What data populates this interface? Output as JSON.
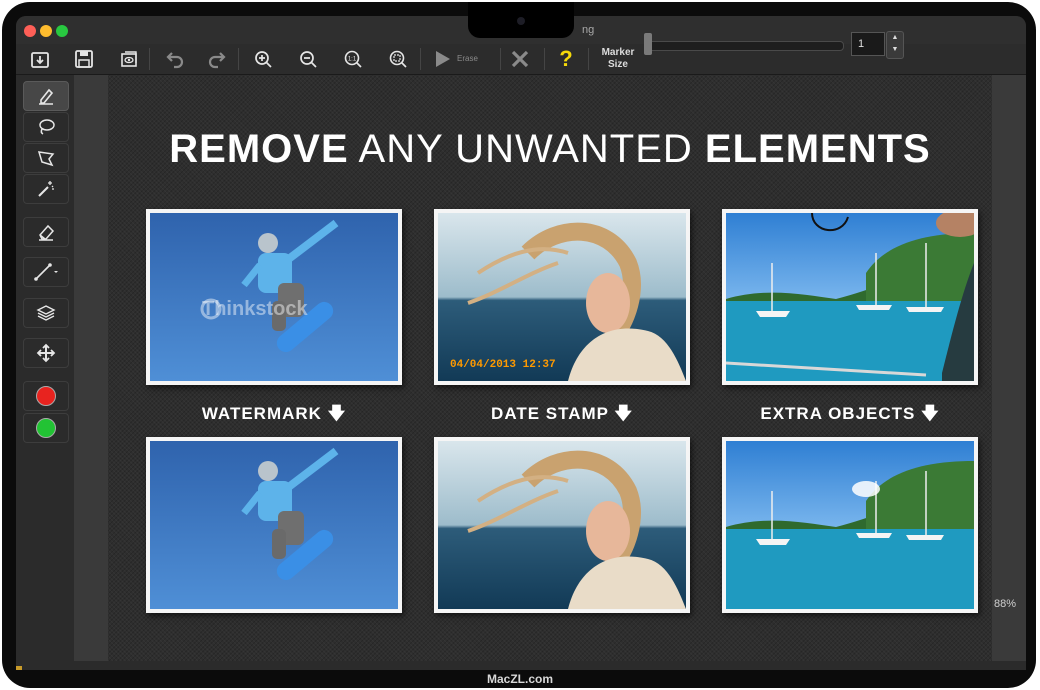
{
  "window": {
    "title": "ng"
  },
  "toolbar": {
    "erase_label": "Erase",
    "help_label": "?",
    "marker_size_label_line1": "Marker",
    "marker_size_label_line2": "Size",
    "marker_size_value": "1",
    "marker_size_fraction": 0.0,
    "icons": [
      "import-icon",
      "save-icon",
      "preview-icon",
      "undo-icon",
      "redo-icon",
      "zoom-in-icon",
      "zoom-out-icon",
      "zoom-actual-icon",
      "zoom-fit-icon",
      "play-icon",
      "close-icon",
      "help-icon"
    ]
  },
  "sidebar": {
    "tools": [
      "marker-icon",
      "lasso-icon",
      "polygon-lasso-icon",
      "magic-wand-icon",
      "eraser-icon",
      "line-icon",
      "layers-icon",
      "move-icon"
    ],
    "colors": {
      "red": "#e8231f",
      "green": "#22c334"
    }
  },
  "canvas": {
    "headline_bold_1": "REMOVE",
    "headline_light": "ANY UNWANTED",
    "headline_bold_2": "ELEMENTS",
    "captions": [
      "WATERMARK",
      "DATE STAMP",
      "EXTRA OBJECTS"
    ],
    "watermark_text": "Thinkstock",
    "date_stamp_text": "04/04/2013 12:37"
  },
  "status": {
    "zoom": "88%"
  },
  "brand": "MacZL.com",
  "colors": {
    "accent_yellow": "#f5d90a",
    "help_yellow": "#f5d90a",
    "sky_blue": "#3a78c4",
    "sea_teal": "#1f9ac0"
  }
}
